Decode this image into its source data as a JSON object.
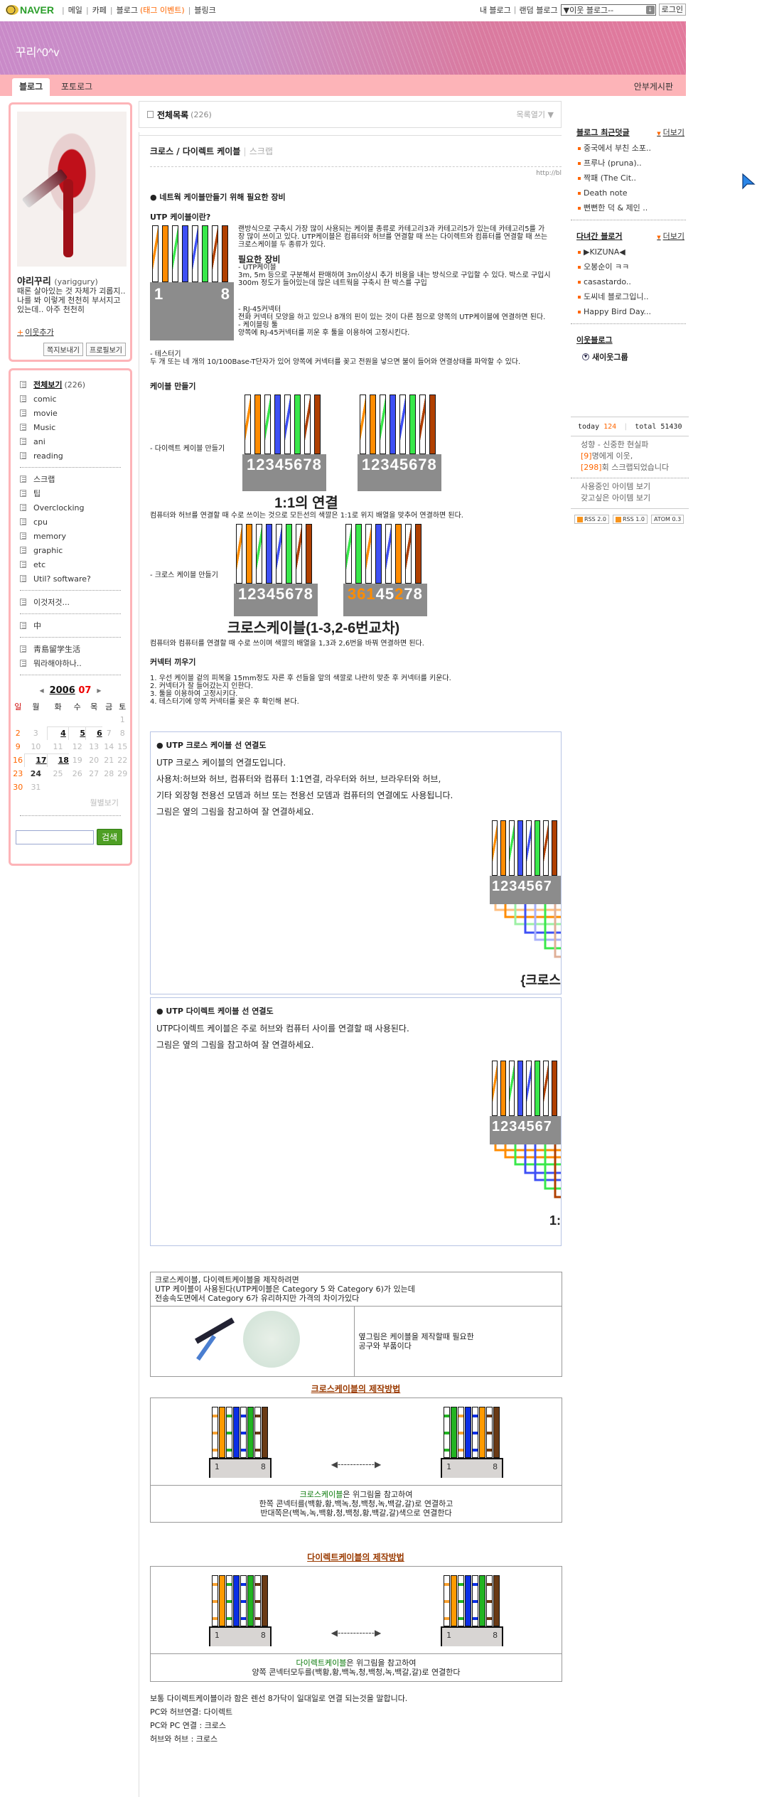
{
  "topbar": {
    "logo": "NAVER",
    "nav": [
      "메일",
      "카페",
      "블로그",
      "(태그 이벤트)",
      "블링크"
    ],
    "my_blog": "내 블로그",
    "random_blog": "랜덤 블로그",
    "neighbor_select": "▼이웃 블로그--",
    "login": "로그인"
  },
  "banner": {
    "title": "꾸리^0^v"
  },
  "tabs": {
    "blog": "블로그",
    "photolog": "포토로그",
    "guestbook": "안부게시판"
  },
  "profile": {
    "name": "야리꾸리",
    "id": "(yariggury)",
    "desc": "때론 살아있는 것 자체가 괴롭지.. 나를 봐 이렇게 천천히 부서지고 있는데.. 아주 천천히",
    "add_neighbor": "이웃추가",
    "send_note": "쪽지보내기",
    "view_profile": "프로필보기"
  },
  "categories": {
    "all_label": "전체보기",
    "all_count": "(226)",
    "groups": [
      [
        "comic",
        "movie",
        "Music",
        "ani",
        "reading"
      ],
      [
        "스크랩",
        "팁",
        "Overclocking",
        "cpu",
        "memory",
        "graphic",
        "etc",
        "Util? software?"
      ],
      [
        "이것저것..."
      ],
      [
        "中"
      ],
      [
        "靑島留学生活",
        "뭐라해야하나.."
      ]
    ]
  },
  "calendar": {
    "year": "2006",
    "month": "07",
    "dow": [
      "일",
      "월",
      "화",
      "수",
      "목",
      "금",
      "토"
    ],
    "weeks": [
      [
        "",
        "",
        "",
        "",
        "",
        "",
        "1"
      ],
      [
        "2",
        "3",
        "4",
        "5",
        "6",
        "7",
        "8"
      ],
      [
        "9",
        "10",
        "11",
        "12",
        "13",
        "14",
        "15"
      ],
      [
        "16",
        "17",
        "18",
        "19",
        "20",
        "21",
        "22"
      ],
      [
        "23",
        "24",
        "25",
        "26",
        "27",
        "28",
        "29"
      ],
      [
        "30",
        "31",
        "",
        "",
        "",
        "",
        ""
      ]
    ],
    "post_days": [
      "4",
      "5",
      "6",
      "17",
      "18"
    ],
    "today": "24",
    "monthly_view": "월별보기"
  },
  "search": {
    "button": "검색",
    "value": ""
  },
  "listbar": {
    "label": "전체목록",
    "count": "(226)",
    "open": "목록열기"
  },
  "post": {
    "title": "크로스 / 다이렉트 케이블",
    "category": "스크랩",
    "url": "http://bl",
    "s1_heading": "● 네트웍 케이블만들기 위해 필요한 장비",
    "utp_heading": "UTP 케이블이란?",
    "utp_text": "랜방식으로 구축시 가장 많이 사용되는 케이블 종류로 카테고리3과 카테고리5가 있는데 카테고리5를 가장 많이 쓰이고 있다. UTP케이블은 컴퓨터와 허브를 연결할 때 쓰는 다이렉트와 컴퓨터를 연결할 때 쓰는 크로스케이블 두 종류가 있다.",
    "equip_heading": "필요한 장비",
    "equip_utp": "- UTP케이블",
    "equip_utp_text": "3m, 5m 등으로 구분해서 판매하며 3m이상시 추가 비용을 내는 방식으로 구입할 수 있다. 박스로 구입시 300m 정도가 들어있는데 많은 네트웍을 구축시 한 박스를 구입",
    "equip_rj": "- RJ-45커넥터",
    "equip_rj_text": "전화 커넥터 모양을 하고 있으나 8개의 핀이 있는 것이 다른 점으로 양쪽의 UTP케이블에 연결하면 된다.",
    "equip_tool": "- 케이블링 툴",
    "equip_tool_text": "양쪽에 RJ-45커넥터를 끼운 후 툴을 이용하여 고정시킨다.",
    "equip_tester": "- 테스터기",
    "equip_tester_text": "두 개 또는 네 개의 10/100Base-T단자가 있어 양쪽에 커넥터를 꽂고 전원을 넣으면 불이 들어와 연결상태를 파악할 수 있다.",
    "pin_first": "1",
    "pin_last": "8",
    "make_heading": "케이블 만들기",
    "direct_label": "- 다이렉트 케이블 만들기",
    "pins_straight": "12345678",
    "one_to_one": "1:1의 연결",
    "direct_text": "컴퓨터와 허브를 연결할 때 수로 쓰이는 것으로 모든선의 색깔은 1:1로 위지 배열을 맞추어 연결하면 된다.",
    "cross_label": "- 크로스 케이블 만들기",
    "pins_cross": [
      "3",
      "6",
      "1",
      "4",
      "5",
      "2",
      "7",
      "8"
    ],
    "cross_caption": "크로스케이블(1-3,2-6번교차)",
    "cross_text": "컴퓨터와 컴퓨터를 연결할 때 수로 쓰이며 색깔의 배열을 1,3과 2,6번을 바꿔 연결하면 된다.",
    "connector_heading": "커넥터 끼우기",
    "connector_steps": [
      "1. 우선 케이블 겉의 피복을 15mm정도 자른 후 선들을 앞의 색깔로 나란히 맞춘 후 커넥터를 키운다.",
      "2. 커넥터가 잘 들어갔는지 인한다.",
      "3. 툴을 이용하여 고정시키다.",
      "4. 테스터기에 양쪽 커넥터를 꽂은 후 확인해 본다."
    ],
    "cross_box": {
      "heading": "● UTP 크로스 케이블 선 연결도",
      "lines": [
        "UTP 크로스 케이블의 연결도입니다.",
        "사용처:허브와 허브, 컴퓨터와 컴퓨터 1:1연결, 라우터와 허브, 브라우터와 허브,",
        "기타 외장형 전용선 모뎀과 허브 또는 전용선 모뎀과 컴퓨터의 연결에도 사용됩니다.",
        "그림은 옆의 그림을 참고하여 잘 연결하세요."
      ],
      "pins": "1234567",
      "caption": "{크로스"
    },
    "direct_box": {
      "heading": "● UTP 다이렉트 케이블 선 연결도",
      "lines": [
        "UTP다이렉트 케이블은 주로 허브와 컴퓨터 사이를 연결할 때 사용된다.",
        "그림은 옆의 그림을 참고하여 잘 연결하세요."
      ],
      "pins": "1234567",
      "caption": "1:"
    },
    "table": {
      "intro": [
        "크로스케이블, 다이렉트케이블을 제작하려면",
        "UTP 케이블이 사용된다(UTP케이블은 Category 5 와 Category 6)가 있는데",
        "전송속도면에서 Category 6가 유리하지만 가격의 차이가있다"
      ],
      "tools_text": [
        "옆그림은 케이블을 제작할때 필요한",
        "공구와 부품이다"
      ],
      "cross_title": "크로스케이블의 제작방법",
      "cross_note_green": "크로스케이블",
      "cross_note": [
        "은 위그림을 참고하여",
        "한쪽 콘넥터를(백황,황,백녹,청,백청,녹,백갈,갈)로 연결하고",
        "반대쪽은(백녹,녹,백황,청,백청,황,백갈,갈)색으로 연결한다"
      ],
      "direct_title": "다이렉트케이블의 제작방법",
      "direct_note_green": "다이렉트케이블",
      "direct_note": [
        "은 위그림을 참고하여",
        "양쪽 콘넥터모두를(백황,황,백녹,청,백청,녹,백갈,갈)로 연결한다"
      ],
      "arrow": "◀------------▶"
    },
    "footer": [
      "보통 다이렉트케이블이라 함은 렌선 8가닥이 일대일로 연결 되는것을 말합니다.",
      "PC와 허브연결: 다이렉트",
      "PC와 PC 연결 : 크로스",
      "허브와 허브 : 크로스"
    ]
  },
  "sidebar_right": {
    "recent_comments": {
      "title": "블로그 최근덧글",
      "more": "더보기",
      "items": [
        "중국에서 부친 소포..",
        "프루나 (pruna)..",
        "짝패 (The Cit..",
        "Death note",
        "뻔뻔한 덕 & 제인 .."
      ]
    },
    "visitors": {
      "title": "다녀간 블로거",
      "more": "더보기",
      "items": [
        "▶KIZUNA◀",
        "오봉순이 ㅋㅋ",
        "casastardo..",
        "도씨네 블로그입니..",
        "Happy Bird Day..."
      ]
    },
    "neighbors": {
      "title": "이웃블로그",
      "group": "새이웃그룹"
    }
  },
  "stats": {
    "today_label": "today",
    "today": "124",
    "total_label": "total",
    "total": "51430",
    "tendency": "성향 - 신중한 현실파",
    "neighbors_count": "[9]",
    "neighbors_text": "명에게 이웃,",
    "scrap_count": "[298]",
    "scrap_text": "회 스크랩되었습니다",
    "items_using": "사용중인 아이템 보기",
    "items_want": "갖고싶은 아이템 보기",
    "rss": [
      "RSS 2.0",
      "RSS 1.0",
      "ATOM 0.3"
    ]
  },
  "colors": {
    "accent": "#ff6600",
    "banner_pink": "#fdb4b8",
    "search_green": "#4e9f24",
    "wire_orange": "#ff8c00",
    "wire_green": "#39e84a",
    "wire_blue": "#3e50f5",
    "wire_brown": "#b04000"
  }
}
